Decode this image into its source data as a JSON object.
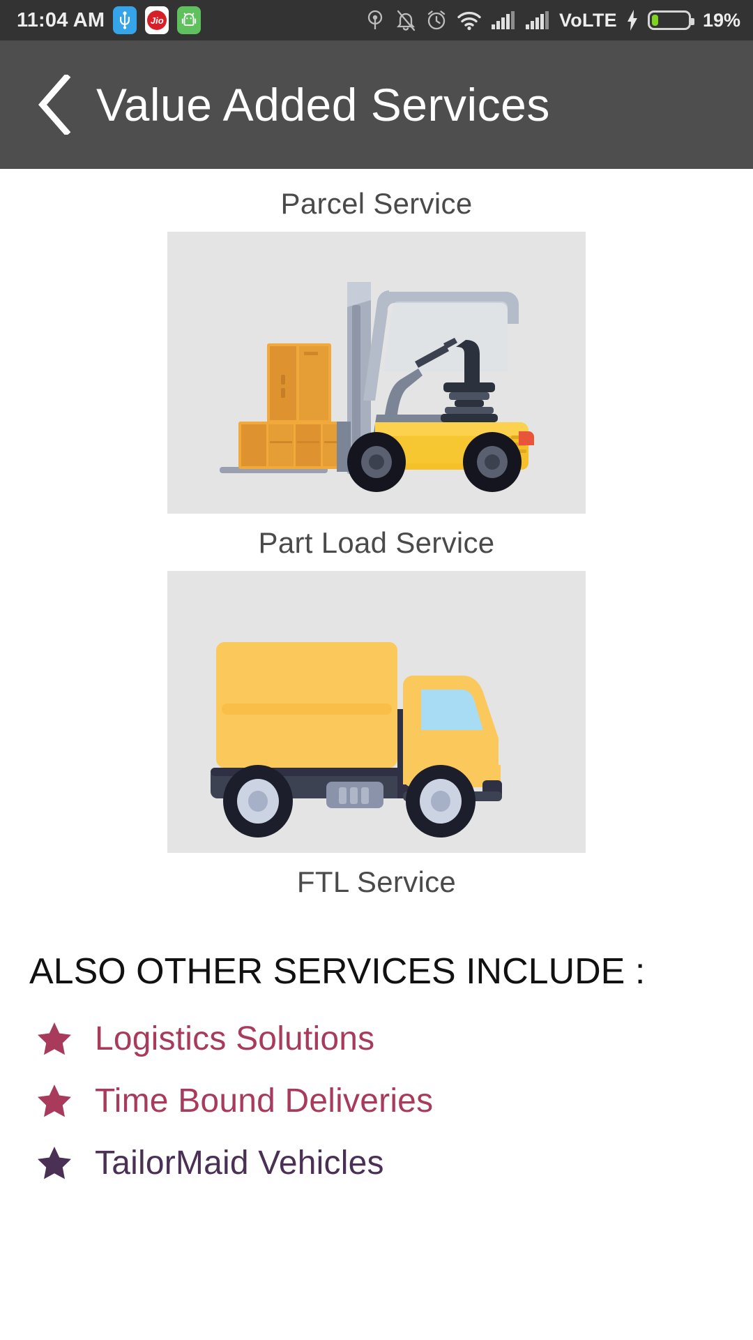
{
  "status_bar": {
    "time": "11:04 AM",
    "jio_label": "Jio",
    "volte_label": "VoLTE",
    "battery_percent": "19%",
    "battery_level": 19,
    "icons": [
      "usb-icon",
      "jio-icon",
      "android-robot-icon",
      "cast-icon",
      "mute-bell-icon",
      "alarm-clock-icon",
      "wifi-icon",
      "signal-sim1-icon",
      "signal-sim2-icon",
      "charging-bolt-icon",
      "battery-icon"
    ]
  },
  "app_bar": {
    "back_label": "Back",
    "title": "Value Added Services",
    "background_color": "#4e4e4e"
  },
  "services": [
    {
      "label": "Parcel Service",
      "image": "forklift-illustration"
    },
    {
      "label": "Part Load Service",
      "image": "truck-illustration"
    },
    {
      "label": "FTL Service",
      "image": null
    }
  ],
  "other_services": {
    "heading": "ALSO OTHER SERVICES INCLUDE :",
    "items": [
      {
        "label": "Logistics Solutions",
        "color": "#A83A5B",
        "bullet": "star-icon"
      },
      {
        "label": "Time Bound Deliveries",
        "color": "#A83A5B",
        "bullet": "star-icon"
      },
      {
        "label": "TailorMaid Vehicles",
        "color": "#4A3055",
        "bullet": "star-icon"
      }
    ]
  },
  "colors": {
    "status_bar_bg": "#333333",
    "app_bar_bg": "#4e4e4e",
    "image_bg": "#e4e4e4",
    "label_text": "#4a4a4a",
    "heading_text": "#111111",
    "crimson": "#A83A5B",
    "purple": "#4A3055",
    "truck_yellow": "#FBC85C",
    "forklift_yellow": "#F5C02A",
    "pallet_orange": "#E8A33D",
    "chassis_navy": "#2F3044"
  }
}
